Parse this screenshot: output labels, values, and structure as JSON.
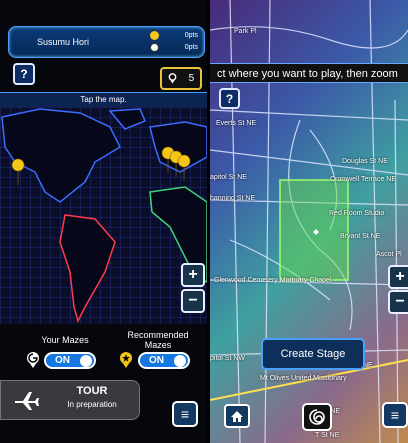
{
  "left": {
    "player": {
      "name": "Susumu Hori",
      "stat1": "0pts",
      "stat2": "0pts"
    },
    "help_label": "?",
    "pins_count": "5",
    "tap_text": "Tap the map.",
    "zoom_in": "+",
    "zoom_out": "−",
    "your_mazes_label": "Your Mazes",
    "recommended_label_1": "Recommended",
    "recommended_label_2": "Mazes",
    "toggle_on": "ON",
    "tour_title": "TOUR",
    "tour_sub": "In preparation",
    "menu_label": "≡"
  },
  "right": {
    "banner": "ct where you want to play, then zoom",
    "help_label": "?",
    "streets": [
      "Park Pl",
      "Everts St NE",
      "Douglas St NE",
      "Cromwell Terrace NE",
      "apitol St NE",
      "hanning St NE",
      "Red Room Studio",
      "Bryant St NE",
      "Ascot Pl",
      "Glenwood Cemetery Mortuary Chapel",
      "pitol St NW",
      "Mt Olives United Missionary",
      "Todd Pl NE",
      "T St NE",
      "NE"
    ],
    "zoom_in": "+",
    "zoom_out": "−",
    "create_stage": "Create Stage",
    "menu_label": "≡"
  },
  "colors": {
    "accent_blue": "#4aa0ff",
    "pin_yellow": "#f5c518",
    "continent_outline": "#3a6cff",
    "selection_green": "#66dd44"
  }
}
